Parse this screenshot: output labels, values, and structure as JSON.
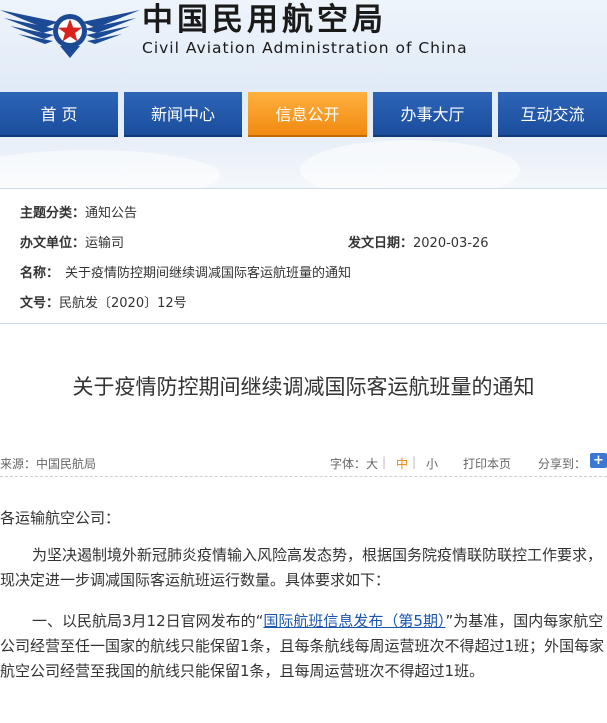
{
  "header": {
    "title_cn": "中国民用航空局",
    "title_en": "Civil Aviation Administration of China"
  },
  "nav": {
    "items": [
      {
        "label": "首 页"
      },
      {
        "label": "新闻中心"
      },
      {
        "label": "信息公开",
        "active": true
      },
      {
        "label": "办事大厅"
      },
      {
        "label": "互动交流"
      }
    ]
  },
  "info": {
    "category_label": "主题分类：",
    "category_value": "通知公告",
    "unit_label": "办文单位：",
    "unit_value": "运输司",
    "date_label": "发文日期：",
    "date_value": "2020-03-26",
    "name_label": "名称：",
    "name_value": "关于疫情防控期间继续调减国际客运航班量的通知",
    "docno_label": "文号：",
    "docno_value": "民航发〔2020〕12号"
  },
  "article": {
    "title": "关于疫情防控期间继续调减国际客运航班量的通知",
    "source": "来源：中国民航局",
    "font_label": "字体：",
    "font_large": "大",
    "sep1": "|",
    "font_medium": "中",
    "sep2": "|",
    "font_small": "小",
    "print_label": "打印本页",
    "share_label": "分享到：",
    "share_plus": "+",
    "salutation": "各运输航空公司：",
    "para1": "为坚决遏制境外新冠肺炎疫情输入风险高发态势，根据国务院疫情联防联控工作要求，现决定进一步调减国际客运航班运行数量。具体要求如下：",
    "para2_prefix": "一、以民航局3月12日官网发布的“",
    "para2_link": "国际航班信息发布（第5期）",
    "para2_suffix": "”为基准，国内每家航空公司经营至任一国家的航线只能保留1条，且每条航线每周运营班次不得超过1班；外国每家航空公司经营至我国的航线只能保留1条，且每周运营班次不得超过1班。"
  },
  "colors": {
    "nav_blue": "#1a4d9c",
    "nav_active": "#f08a10",
    "link": "#1a55b0"
  }
}
